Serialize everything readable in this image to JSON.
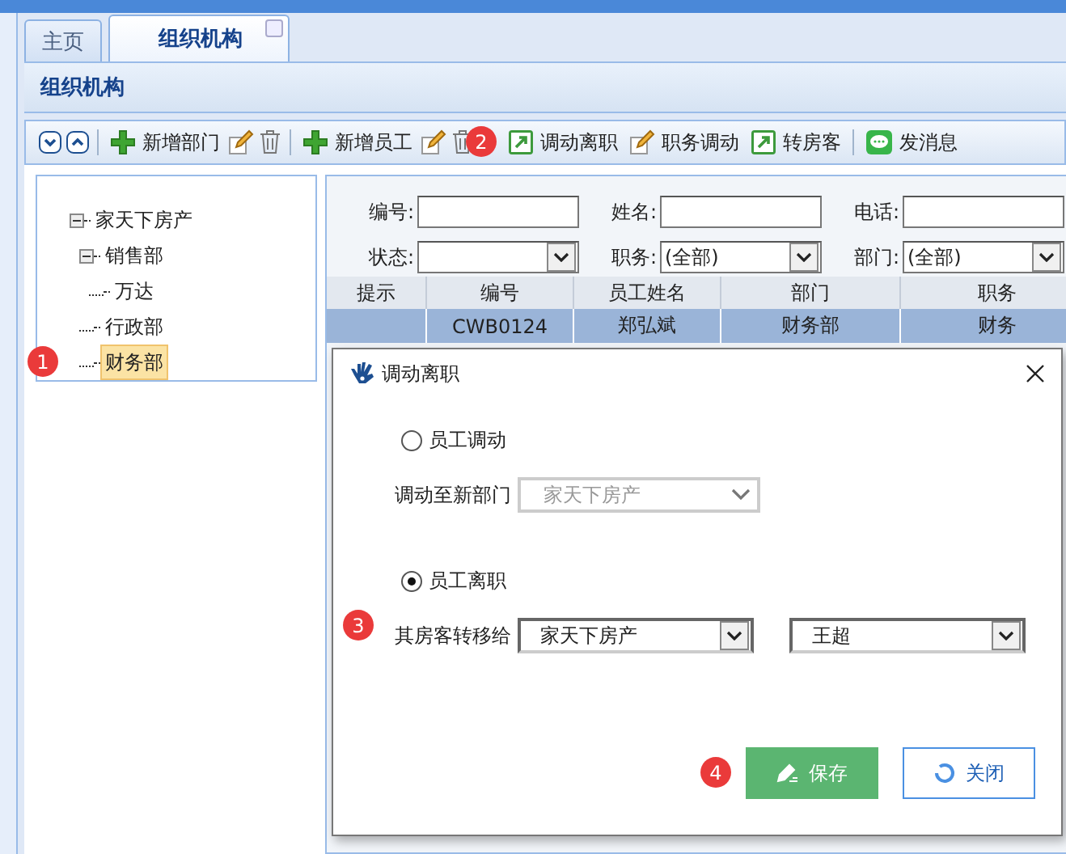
{
  "tabs": [
    {
      "label": "主页",
      "selected": false,
      "closable": false
    },
    {
      "label": "组织机构",
      "selected": true,
      "closable": true
    }
  ],
  "panel_title": "组织机构",
  "toolbar": [
    {
      "kind": "down"
    },
    {
      "kind": "up"
    },
    {
      "kind": "separator"
    },
    {
      "kind": "add",
      "label": "新增部门"
    },
    {
      "kind": "edit"
    },
    {
      "kind": "delete"
    },
    {
      "kind": "separator"
    },
    {
      "kind": "add",
      "label": "新增员工"
    },
    {
      "kind": "edit"
    },
    {
      "kind": "delete",
      "callout": "2"
    },
    {
      "kind": "move",
      "label": "调动离职"
    },
    {
      "kind": "edit",
      "label": "职务调动"
    },
    {
      "kind": "move",
      "label": "转房客"
    },
    {
      "kind": "separator"
    },
    {
      "kind": "message",
      "label": "发消息"
    }
  ],
  "tree": [
    {
      "label": "家天下房产",
      "selected": false,
      "expanded": true,
      "children": [
        {
          "label": "销售部",
          "selected": false,
          "expanded": true,
          "children": [
            {
              "label": "万达",
              "selected": false
            }
          ]
        },
        {
          "label": "行政部",
          "selected": false
        },
        {
          "label": "财务部",
          "selected": true,
          "callout": "1"
        }
      ]
    }
  ],
  "filters": [
    {
      "label": "编号:",
      "kind": "text"
    },
    {
      "label": "姓名:",
      "kind": "text"
    },
    {
      "label": "电话:",
      "kind": "text"
    },
    {
      "label": "状态:",
      "kind": "select"
    },
    {
      "label": "职务:",
      "kind": "select",
      "value": "(全部)"
    },
    {
      "label": "部门:",
      "kind": "select",
      "value": "(全部)"
    }
  ],
  "table": {
    "columns": [
      "提示",
      "编号",
      "员工姓名",
      "部门",
      "职务"
    ],
    "rows": [
      {
        "selected": true,
        "cells": [
          null,
          "CWB0124",
          "郑弘斌",
          "财务部",
          "财务"
        ]
      }
    ]
  },
  "dialog": {
    "title": "调动离职",
    "options": [
      {
        "label": "员工调动",
        "selected": false,
        "field_label": "调动至新部门",
        "selects": [
          {
            "value": "家天下房产",
            "disabled": true
          }
        ]
      },
      {
        "label": "员工离职",
        "selected": true,
        "field_label": "其房客转移给",
        "callout": "3",
        "selects": [
          {
            "value": "家天下房产",
            "disabled": false
          },
          {
            "value": "王超",
            "disabled": false
          }
        ]
      }
    ],
    "buttons": [
      {
        "label": "保存",
        "kind": "primary",
        "callout": "4"
      },
      {
        "label": "关闭",
        "kind": "secondary"
      }
    ]
  }
}
